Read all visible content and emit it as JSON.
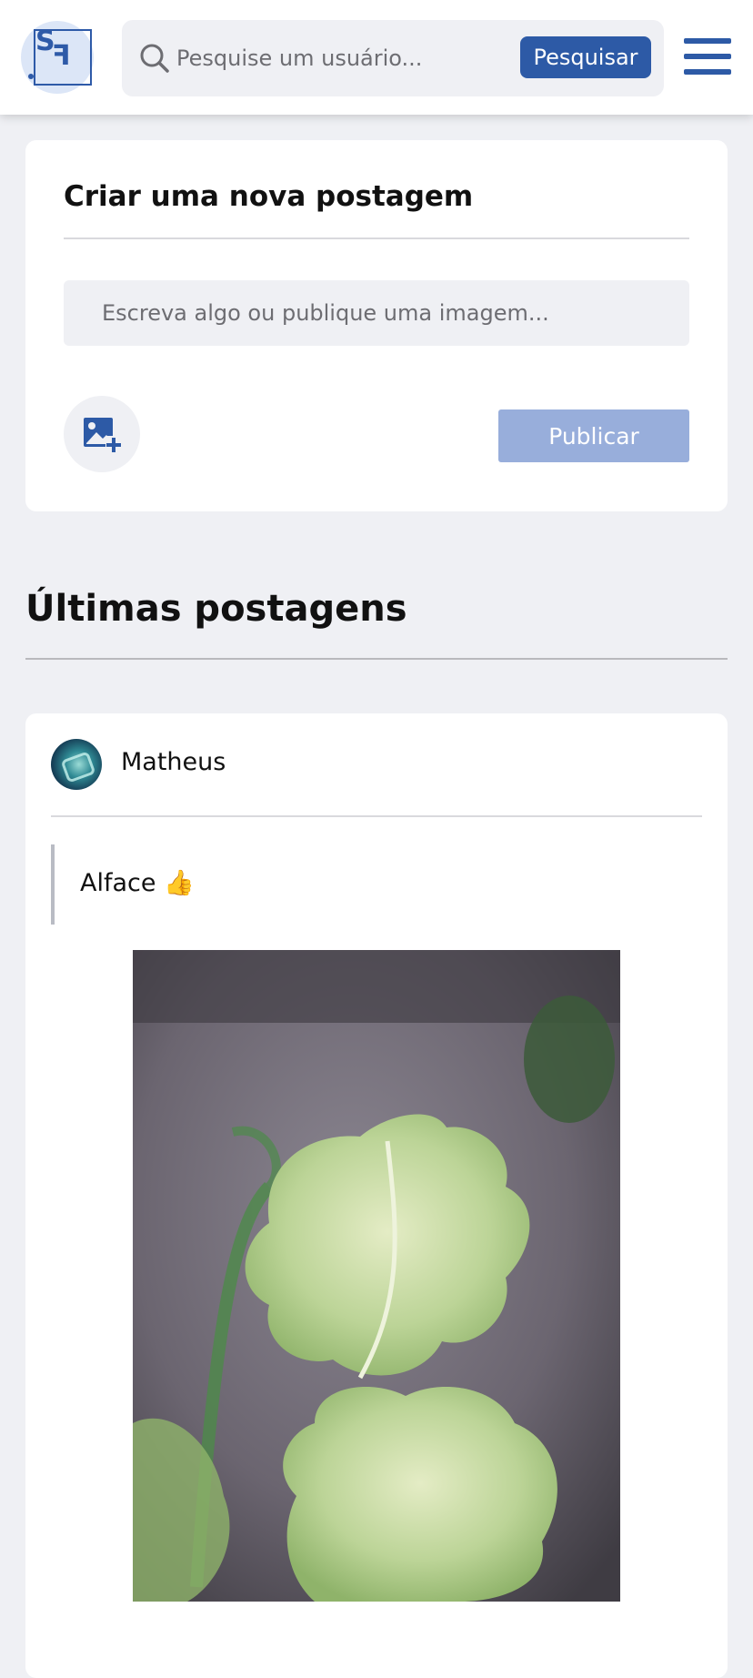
{
  "header": {
    "logo_text": "SF",
    "search_placeholder": "Pesquise um usuário...",
    "search_button": "Pesquisar"
  },
  "new_post": {
    "title": "Criar uma nova postagem",
    "input_placeholder": "Escreva algo ou publique uma imagem...",
    "publish_button": "Publicar"
  },
  "feed": {
    "title": "Últimas postagens",
    "posts": [
      {
        "author": "Matheus",
        "text": "Alface 👍"
      }
    ]
  },
  "colors": {
    "accent": "#2d5aa6",
    "disabled_button": "#98aedb",
    "background": "#eff0f4"
  }
}
